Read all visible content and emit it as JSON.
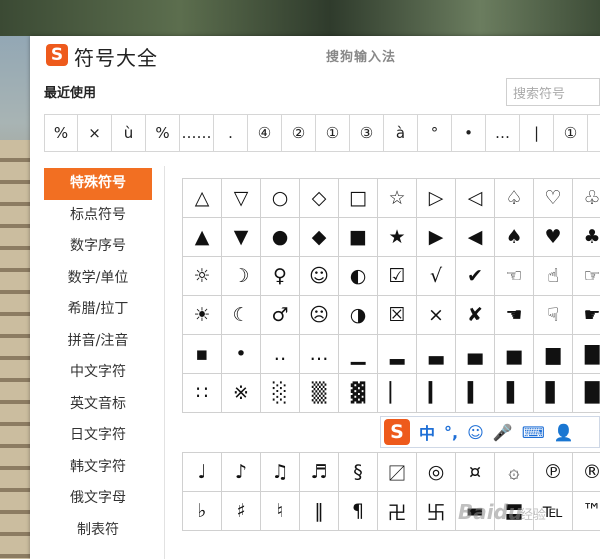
{
  "window": {
    "logo_letter": "S",
    "title": "符号大全",
    "ime_title": "搜狗输入法",
    "recent_label": "最近使用",
    "search_placeholder": "搜索符号"
  },
  "recent_symbols": [
    "%",
    "×",
    "ù",
    "%",
    "……",
    ".",
    "④",
    "②",
    "①",
    "③",
    "à",
    "°",
    "•",
    "…",
    "|",
    "①"
  ],
  "sidebar": {
    "items": [
      {
        "label": "特殊符号",
        "active": true
      },
      {
        "label": "标点符号",
        "active": false
      },
      {
        "label": "数字序号",
        "active": false
      },
      {
        "label": "数学/单位",
        "active": false
      },
      {
        "label": "希腊/拉丁",
        "active": false
      },
      {
        "label": "拼音/注音",
        "active": false
      },
      {
        "label": "中文字符",
        "active": false
      },
      {
        "label": "英文音标",
        "active": false
      },
      {
        "label": "日文字符",
        "active": false
      },
      {
        "label": "韩文字符",
        "active": false
      },
      {
        "label": "俄文字母",
        "active": false
      },
      {
        "label": "制表符",
        "active": false
      }
    ]
  },
  "symbol_grid_1": [
    [
      "△",
      "▽",
      "○",
      "◇",
      "□",
      "☆",
      "▷",
      "◁",
      "♤",
      "♡",
      "♧"
    ],
    [
      "▲",
      "▼",
      "●",
      "◆",
      "■",
      "★",
      "▶",
      "◀",
      "♠",
      "♥",
      "♣"
    ],
    [
      "☼",
      "☽",
      "♀",
      "☺",
      "◐",
      "☑",
      "√",
      "✔",
      "☜",
      "☝",
      "☞"
    ],
    [
      "☀",
      "☾",
      "♂",
      "☹",
      "◑",
      "☒",
      "×",
      "✘",
      "☚",
      "☟",
      "☛"
    ],
    [
      "▪",
      "•",
      "‥",
      "…",
      "▁",
      "▂",
      "▃",
      "▄",
      "▅",
      "▆",
      "▇"
    ],
    [
      "∷",
      "※",
      "░",
      "▒",
      "▓",
      "▏",
      "▎",
      "▍",
      "▌",
      "▋",
      "█"
    ]
  ],
  "symbol_grid_2": [
    [
      "♩",
      "♪",
      "♫",
      "♬",
      "§",
      "〼",
      "◎",
      "¤",
      "۞",
      "℗",
      "®"
    ],
    [
      "♭",
      "♯",
      "♮",
      "‖",
      "¶",
      "卍",
      "卐",
      "▬",
      "〓",
      "℡",
      "™"
    ]
  ],
  "ime_toolbar": {
    "logo_letter": "S",
    "items": [
      "中",
      "°,",
      "☺",
      "🎤",
      "⌨",
      "👤"
    ]
  },
  "watermark": {
    "text": "Baidu",
    "subtext": "经验"
  }
}
